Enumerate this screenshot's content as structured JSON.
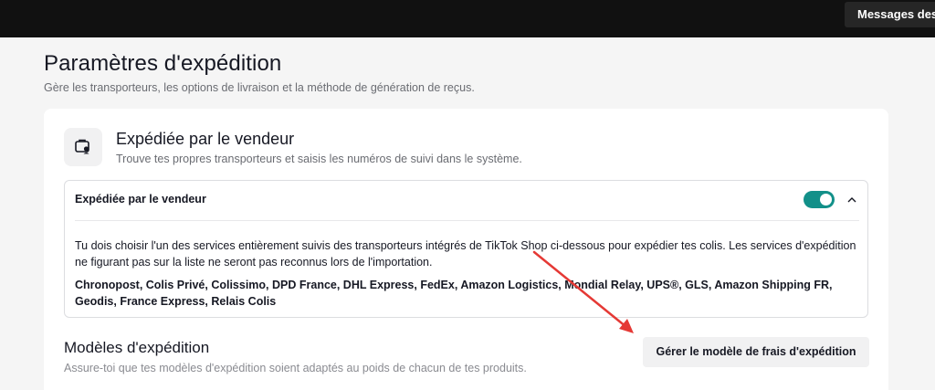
{
  "topbar": {
    "messages_label": "Messages des"
  },
  "page": {
    "title": "Paramètres d'expédition",
    "subtitle": "Gère les transporteurs, les options de livraison et la méthode de génération de reçus."
  },
  "seller_shipping": {
    "icon": "truck-box-icon",
    "title": "Expédiée par le vendeur",
    "subtitle": "Trouve tes propres transporteurs et saisis les numéros de suivi dans le système.",
    "panel": {
      "title": "Expédiée par le vendeur",
      "toggle_on": true,
      "description": "Tu dois choisir l'un des services entièrement suivis des transporteurs intégrés de TikTok Shop ci-dessous pour expédier tes colis. Les services d'expédition ne figurant pas sur la liste ne seront pas reconnus lors de l'importation.",
      "carriers": "Chronopost, Colis Privé, Colissimo, DPD France, DHL Express, FedEx, Amazon Logistics, Mondial Relay, UPS®, GLS, Amazon Shipping FR, Geodis, France Express, Relais Colis"
    }
  },
  "templates": {
    "title": "Modèles d'expédition",
    "subtitle": "Assure-toi que tes modèles d'expédition soient adaptés au poids de chacun de tes produits.",
    "manage_button": "Gérer le modèle de frais d'expédition"
  },
  "colors": {
    "accent": "#129089",
    "annotation_arrow": "#e53935"
  }
}
